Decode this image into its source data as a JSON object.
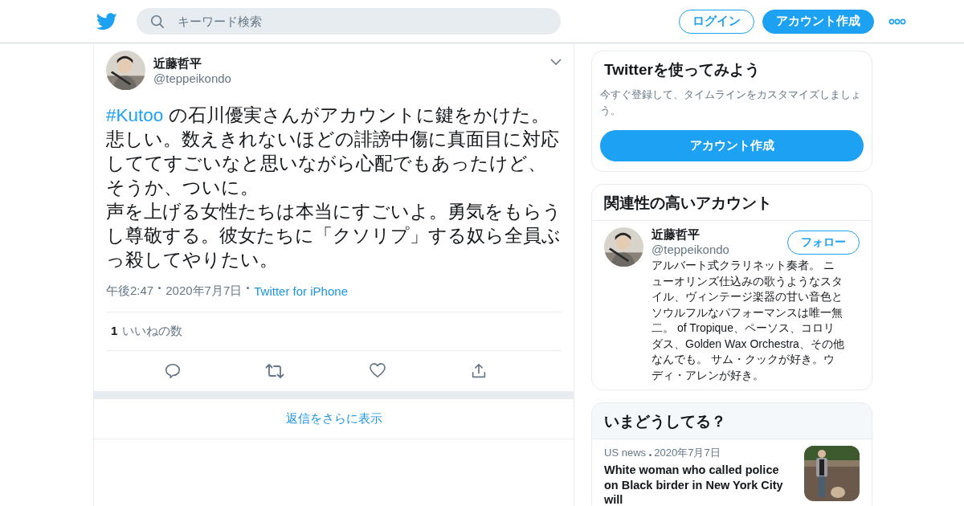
{
  "header": {
    "search": {
      "placeholder": "キーワード検索"
    },
    "buttons": [
      {
        "kind": "outline",
        "label": "ログイン"
      },
      {
        "kind": "filled",
        "label": "アカウント作成"
      }
    ]
  },
  "tweet": {
    "author": {
      "name": "近藤哲平",
      "handle": "@teppeikondo"
    },
    "hashtag": "#Kutoo",
    "paragraphs": [
      " の石川優実さんがアカウントに鍵をかけた。悲しい。数えきれないほどの誹謗中傷に真面目に対応しててすごいなと思いながら心配でもあったけど、そうか、ついに。",
      "声を上げる女性たちは本当にすごいよ。勇気をもらうし尊敬する。彼女たちに「クソリプ」する奴ら全員ぶっ殺してやりたい。"
    ],
    "time": "午後2:47",
    "date": "2020年7月7日",
    "source": "Twitter for iPhone",
    "likes": {
      "count": "1",
      "label": "いいねの数"
    },
    "actions": [
      {
        "kind": "reply"
      },
      {
        "kind": "retweet"
      },
      {
        "kind": "like"
      },
      {
        "kind": "share"
      }
    ],
    "more_replies": "返信をさらに表示"
  },
  "signup_card": {
    "title": "Twitterを使ってみよう",
    "text": "今すぐ登録して、タイムラインをカスタマイズしましょう。",
    "button": "アカウント作成"
  },
  "related": {
    "title": "関連性の高いアカウント",
    "accounts": [
      {
        "name": "近藤哲平",
        "handle": "@teppeikondo",
        "button": "フォロー",
        "bio": "アルバート式クラリネット奏者。 ニューオリンズ仕込みの歌うようなスタイル、ヴィンテージ楽器の甘い音色とソウルフルなパフォーマンスは唯一無二。 of Tropique、ペーソス、コロリダス、Golden Wax Orchestra、その他なんでも。 サム・クックが好き。ウディ・アレンが好き。"
      }
    ]
  },
  "trends": {
    "title": "いまどうしてる？",
    "items": [
      {
        "category": "US news",
        "date": "2020年7月7日",
        "headline": "White woman who called police on Black birder in New York City will"
      }
    ]
  }
}
